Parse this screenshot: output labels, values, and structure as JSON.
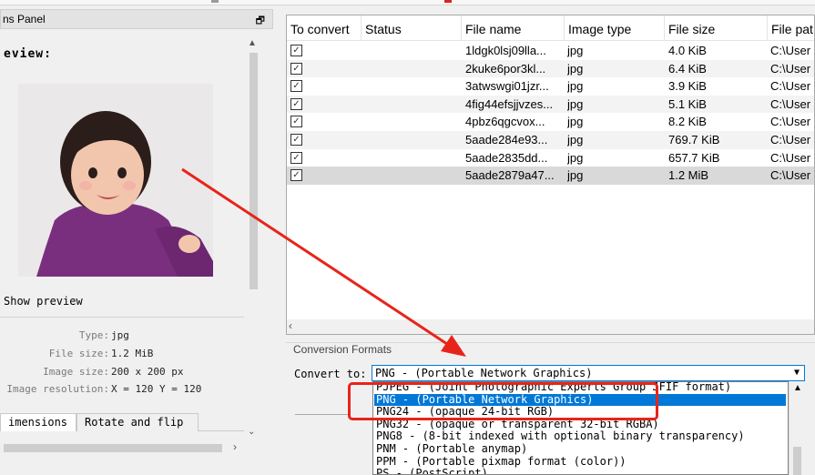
{
  "left_panel": {
    "title": "ns Panel",
    "pin_glyph": "🗗",
    "preview_heading": "eview:",
    "show_preview_label": "Show preview",
    "info": [
      {
        "label": "Type:",
        "value": "jpg"
      },
      {
        "label": "File size:",
        "value": "1.2 MiB"
      },
      {
        "label": "Image size:",
        "value": "200 x 200 px"
      },
      {
        "label": "Image resolution:",
        "value": "X = 120 Y = 120"
      }
    ],
    "tabs": [
      {
        "label": "imensions"
      },
      {
        "label": "Rotate and flip"
      }
    ]
  },
  "file_table": {
    "columns": [
      "To convert",
      "Status",
      "File name",
      "Image type",
      "File size",
      "File pat"
    ],
    "rows": [
      {
        "checked": "✓",
        "status": "",
        "name": "1ldgk0lsj09lla...",
        "type": "jpg",
        "size": "4.0 KiB",
        "path": "C:\\User"
      },
      {
        "checked": "✓",
        "status": "",
        "name": "2kuke6por3kl...",
        "type": "jpg",
        "size": "6.4 KiB",
        "path": "C:\\User"
      },
      {
        "checked": "✓",
        "status": "",
        "name": "3atwswgi01jzr...",
        "type": "jpg",
        "size": "3.9 KiB",
        "path": "C:\\User"
      },
      {
        "checked": "✓",
        "status": "",
        "name": "4fig44efsjjvzes...",
        "type": "jpg",
        "size": "5.1 KiB",
        "path": "C:\\User"
      },
      {
        "checked": "✓",
        "status": "",
        "name": "4pbz6qgcvox...",
        "type": "jpg",
        "size": "8.2 KiB",
        "path": "C:\\User"
      },
      {
        "checked": "✓",
        "status": "",
        "name": "5aade284e93...",
        "type": "jpg",
        "size": "769.7 KiB",
        "path": "C:\\User"
      },
      {
        "checked": "✓",
        "status": "",
        "name": "5aade2835dd...",
        "type": "jpg",
        "size": "657.7 KiB",
        "path": "C:\\User"
      },
      {
        "checked": "✓",
        "status": "",
        "name": "5aade2879a47...",
        "type": "jpg",
        "size": "1.2 MiB",
        "path": "C:\\User"
      }
    ],
    "selected_row": 7
  },
  "conversion": {
    "group_title": "Conversion Formats",
    "convert_to_label": "Convert to:",
    "selected": "PNG - (Portable Network Graphics)",
    "options": [
      "PJPEG - (Joint Photographic Experts Group JFIF format)",
      "PNG - (Portable Network Graphics)",
      "PNG24 - (opaque 24-bit RGB)",
      "PNG32 - (opaque or transparent 32-bit RGBA)",
      "PNG8 - (8-bit indexed with optional binary transparency)",
      "PNM - (Portable anymap)",
      "PPM - (Portable pixmap format (color))",
      "PS - (PostScript)"
    ],
    "highlighted_index": 1
  },
  "colors": {
    "annotation_red": "#e8241a",
    "selection_blue": "#0078d7"
  }
}
